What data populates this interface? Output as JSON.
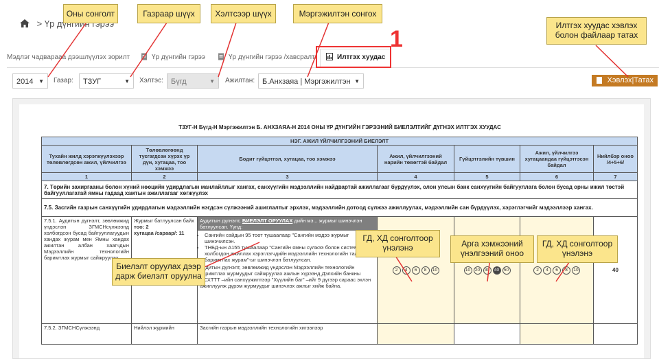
{
  "breadcrumb": {
    "separator": ">",
    "current": "Үр дүнгийн гэрээ"
  },
  "tabs": [
    {
      "label": "Мэдлэг чадварааа дээшлүүлэх зорилт"
    },
    {
      "label": "Үр дүнгийн гэрээ"
    },
    {
      "label": "Үр дүнгийн гэрээ /хавсралт/"
    },
    {
      "label": "Илтгэх хуудас"
    }
  ],
  "filters": {
    "year": "2014",
    "region_label": "Газар:",
    "region_value": "ТЗУГ",
    "division_label": "Хэлтэс:",
    "division_value": "Бүгд",
    "employee_label": "Ажилтан:",
    "employee_value": "Б.Анхзаяа | Мэргэжилтэн"
  },
  "export_button": "Хэвлэх|Татах",
  "document": {
    "title": "ТЗУГ-Н Бүгд-Н Мэргэжилтэн Б. АНХЗАЯА-Н 2014 ОНЫ ҮР ДҮНГИЙН ГЭРЭЭНИЙ БИЕЛЭЛТИЙГ ДҮГНЭХ ИЛТГЭХ ХУУДАС",
    "section_header": "НЭГ. АЖИЛ ҮЙЛЧИЛГЭЭНИЙ БИЕЛЭЛТ",
    "columns": [
      "Тухайн жилд хэрэгжүүлэхээр төлөвлөгдсөн ажил, үйлчилгээ",
      "Төлөвлөгөөнд тусгагдсан хүрэх үр дүн, хугацаа, тоо хэмжээ",
      "Бодит гүйцэтгэл, хугацаа, тоо хэмжээ",
      "Ажил, үйлчилгээний нарийн төвөгтэй байдал",
      "Гүйцэтгэлийн түвшин",
      "Ажил, үйлчилгээ хугацаандаа гүйцэтгэсэн байдал",
      "Нийлбэр оноо /4+5+6/"
    ],
    "column_numbers": [
      "1",
      "2",
      "3",
      "4",
      "5",
      "6",
      "7"
    ],
    "goal_row": "7. Төрийн захиргааны болон хүний нөөцийн удирдлагын манлайллыг хангах, санхүүгийн мэдээллийн найдвартай ажиллагааг бүрдүүлэх, олон улсын банк санхүүгийн байгууллага болон бусад орны ижил төстэй байгууллагатай ямны гадаад хамтын ажиллагааг хөгжүүлэх",
    "subgoal_row": "7.5. Засгийн газрын санхүүгийн удирдлагын мэдээллийн нэгдсэн сүлжээний ашиглалтыг эрхлэх, мэдээллийн дотоод сүлжээ ажиллуулах, мэдээллийн сан бүрдүүлэх, хэрэглэгчийг мэдээллээр хангах.",
    "row1": {
      "task": "7.5.1. Аудитын дүгнэлт, зөвлөмжид үндэслэн ЗГМСНсүлжээнд холбогдсон бусад байгууллагуудын хандах журам мен Ямны хандах ажилтан албан хаагчдын Мэдээллийн технологийн баримтлах журмыг сайжруулах",
      "target_prefix": "Журмыг батлуулсан байх",
      "target_qty": "тоо: 2",
      "target_time": "хугацаа /сараар/: 11",
      "result_head": "Аудитын дүгнэлт,",
      "result_link": "БИЕЛЭЛТ ОРУУЛАХ",
      "result_tail": "дийн мэ... журмыг шинэчлэн батлуулсан. Үүнд:",
      "bullet1": "Сангийн сайдын 95 тоот тушаалаар \"Сангийн мэдээ журмыг шинэчилсэн.",
      "bullet2": "ТНБД-ын А155 тушаалаар \"Сангийн ямны сүлжээ болон системд холбогдон ажиллах хэрэглэгчдийн мэдээллийн технологийн талаар баримтлах журам\"-ыг шинэчлэн батлуулсан.",
      "result_para": "Аудитын дүгнэлт, зөвлөмжид үндэслэн Мэдээллийн технологийн баримтлах журмуудыг сайжруулах ажлын хүрээнд Дэлхийн банкны ОСХТТТ –ийн санхүүжилтээр \"Хүүлийн баг\" –ийг 9 дүгээр сараас эхлэн ажиллуулж дүрэм журмуудыг шинэчлэх ажлыг хийж байна.",
      "complexity_options": [
        "2",
        "4",
        "6",
        "8",
        "10"
      ],
      "level_options": [
        "10",
        "20",
        "30",
        "40",
        "50"
      ],
      "level_selected": "40",
      "timeliness_options": [
        "2",
        "4",
        "6",
        "8",
        "10"
      ],
      "total": "40"
    },
    "row2": {
      "task": "7.5.2. ЗГМСНСүлжээнд",
      "target": "Нийлэл журмийн",
      "result": "Засгийн газрын мэдээллийн технологийн хигээлээр"
    }
  },
  "callouts": {
    "c_year": "Оны сонголт",
    "c_region": "Газраар шүүх",
    "c_division": "Хэлтсээр шүүх",
    "c_employee": "Мэргэжилтэн сонгох",
    "c_export": "Илтгэх хуудас хэвлэх болон файлаар татах",
    "c_enter": "Биелэлт оруулах дээр дарж биелэлт оруулна",
    "c_complexity": "ГД, ХД сонголтоор үнэлэнэ",
    "c_level": "Арга хэмжээний үнэлгээний оноо",
    "c_timeliness": "ГД, ХД сонголтоор үнэлэнэ",
    "step_number": "1"
  },
  "colors": {
    "accent_orange": "#c47a23",
    "callout_yellow": "#fbe58c",
    "header_blue": "#c6d9f1",
    "pointer_red": "#e33333"
  }
}
